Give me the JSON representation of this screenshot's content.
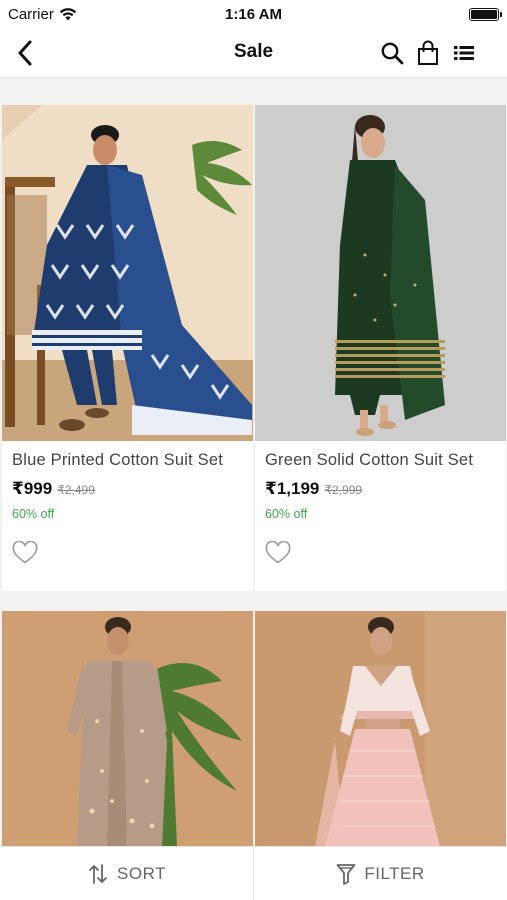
{
  "status_bar": {
    "carrier": "Carrier",
    "time": "1:16 AM"
  },
  "nav": {
    "title": "Sale",
    "icons": [
      "back-icon",
      "search-icon",
      "shopping-bag-icon",
      "list-view-icon"
    ]
  },
  "products": [
    {
      "name": "Blue Printed Cotton Suit Set",
      "price": "₹999",
      "mrp": "₹2,499",
      "discount": "60% off",
      "image": "woman in blue printed suit seated on chair"
    },
    {
      "name": "Green Solid Cotton Suit Set",
      "price": "₹1,199",
      "mrp": "₹2,999",
      "discount": "60% off",
      "image": "woman in dark green suit"
    },
    {
      "name": "",
      "price": "",
      "mrp": "",
      "discount": "",
      "image": "woman in beige embellished jacket set"
    },
    {
      "name": "",
      "price": "",
      "mrp": "",
      "discount": "",
      "image": "woman in pink lehenga set"
    }
  ],
  "bottom_bar": {
    "sort_label": "SORT",
    "filter_label": "FILTER"
  },
  "colors": {
    "discount": "#3ea34a",
    "background": "#f2f2f2",
    "text": "#222222"
  }
}
